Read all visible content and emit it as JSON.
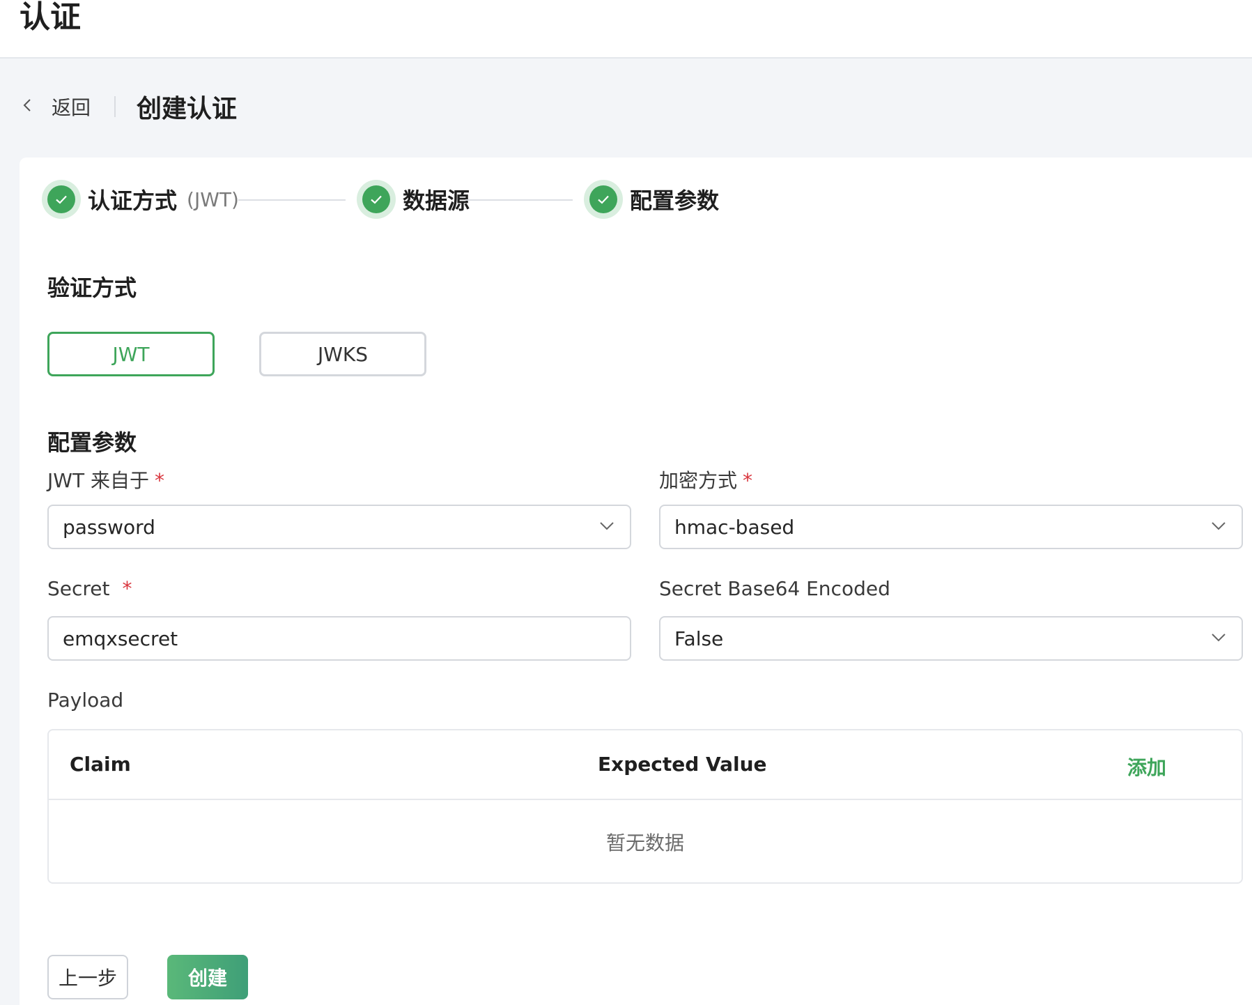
{
  "app": {
    "title": "认证"
  },
  "breadcrumb": {
    "back_label": "返回",
    "page_title": "创建认证"
  },
  "steps": [
    {
      "label": "认证方式",
      "sub": "(JWT)",
      "status": "done"
    },
    {
      "label": "数据源",
      "sub": "",
      "status": "done"
    },
    {
      "label": "配置参数",
      "sub": "",
      "status": "done"
    }
  ],
  "verify_method": {
    "title": "验证方式",
    "options": [
      {
        "label": "JWT",
        "selected": true
      },
      {
        "label": "JWKS",
        "selected": false
      }
    ]
  },
  "config": {
    "title": "配置参数",
    "jwt_from": {
      "label": "JWT 来自于",
      "required_mark": "*",
      "value": "password"
    },
    "algorithm": {
      "label": "加密方式",
      "required_mark": "*",
      "value": "hmac-based"
    },
    "secret": {
      "label": "Secret",
      "required_mark": "*",
      "value": "emqxsecret"
    },
    "secret_base64": {
      "label": "Secret Base64 Encoded",
      "value": "False"
    },
    "payload": {
      "label": "Payload",
      "columns": [
        "Claim",
        "Expected Value"
      ],
      "add_label": "添加",
      "empty_text": "暂无数据"
    }
  },
  "footer": {
    "prev_label": "上一步",
    "create_label": "创建"
  },
  "colors": {
    "accent": "#3ea55a",
    "required": "#d9363e"
  }
}
